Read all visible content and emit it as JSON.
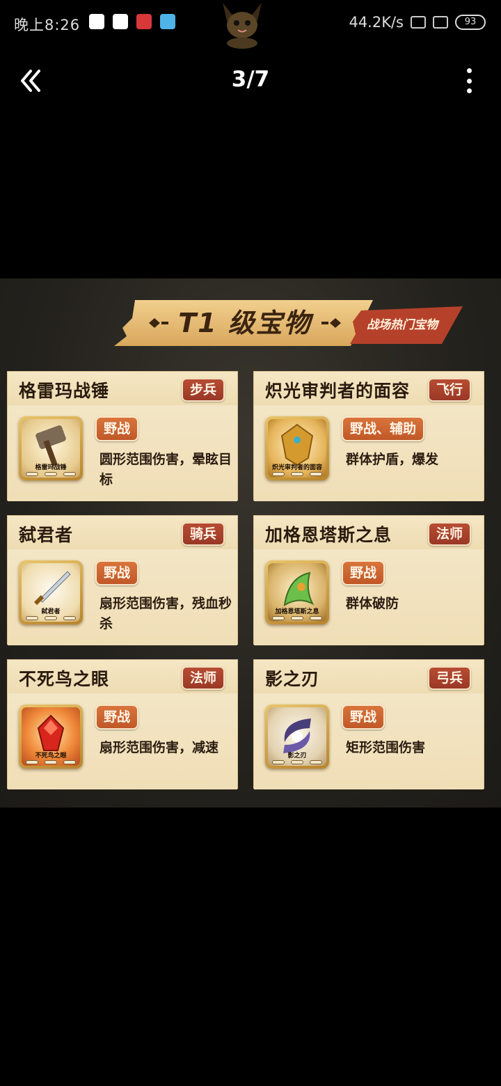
{
  "status_bar": {
    "time": "晚上8:26",
    "speed": "44.2K/s",
    "battery": "93"
  },
  "viewer": {
    "page_counter": "3/7"
  },
  "poster": {
    "title": "T1 级宝物",
    "tag": "战场热门宝物",
    "cards": [
      {
        "name": "格雷玛战锤",
        "type": "步兵",
        "category": "野战",
        "effect": "圆形范围伤害，晕眩目标",
        "icon_label": "格雷玛战锤"
      },
      {
        "name": "炽光审判者的面容",
        "type": "飞行",
        "category": "野战、辅助",
        "effect": "群体护盾，爆发",
        "icon_label": "炽光审判者的面容"
      },
      {
        "name": "弑君者",
        "type": "骑兵",
        "category": "野战",
        "effect": "扇形范围伤害，残血秒杀",
        "icon_label": "弑君者"
      },
      {
        "name": "加格恩塔斯之息",
        "type": "法师",
        "category": "野战",
        "effect": "群体破防",
        "icon_label": "加格恩塔斯之息"
      },
      {
        "name": "不死鸟之眼",
        "type": "法师",
        "category": "野战",
        "effect": "扇形范围伤害，减速",
        "icon_label": "不死鸟之眼"
      },
      {
        "name": "影之刃",
        "type": "弓兵",
        "category": "野战",
        "effect": "矩形范围伤害",
        "icon_label": "影之刃"
      }
    ]
  }
}
